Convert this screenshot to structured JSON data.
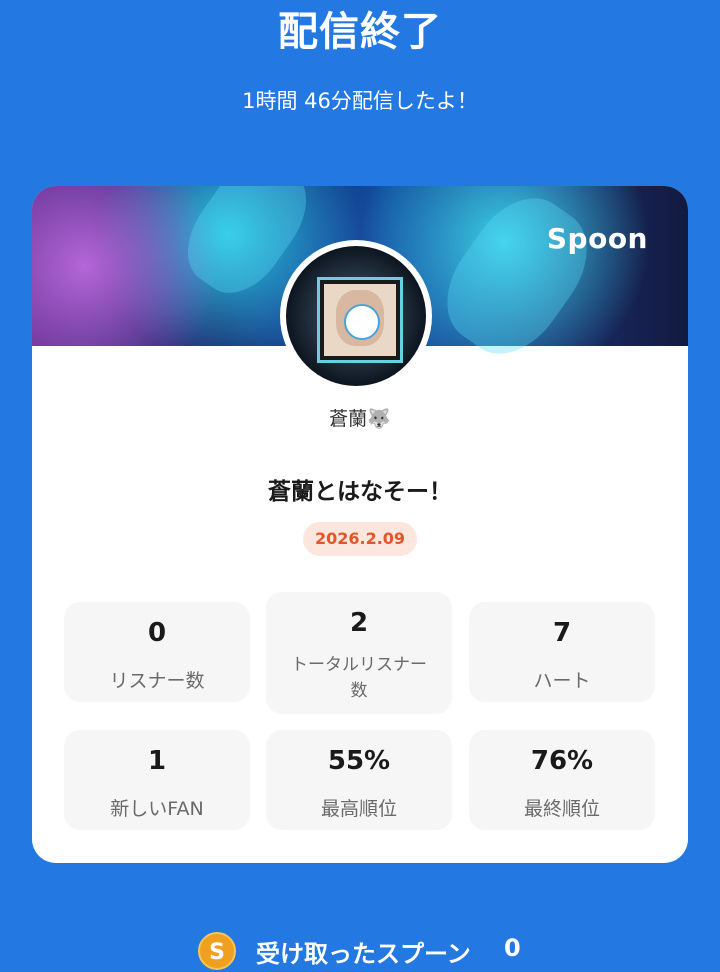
{
  "header": {
    "title": "配信終了",
    "subtitle": "1時間 46分配信したよ！"
  },
  "card": {
    "brand": "Spoon",
    "username": "蒼蘭🐺",
    "stream_title": "蒼蘭とはなそー！",
    "date": "2026.2.09",
    "stats": [
      {
        "value": "0",
        "label": "リスナー数"
      },
      {
        "value": "2",
        "label": "トータルリスナー数"
      },
      {
        "value": "7",
        "label": "ハート"
      },
      {
        "value": "1",
        "label": "新しいFAN"
      },
      {
        "value": "55%",
        "label": "最高順位"
      },
      {
        "value": "76%",
        "label": "最終順位"
      }
    ]
  },
  "spoons": {
    "coin_glyph": "S",
    "label": "受け取ったスプーン",
    "count": "0"
  },
  "colors": {
    "background": "#2478e2",
    "date_badge_text": "#e5552b",
    "date_badge_bg": "#fde6dd",
    "coin": "#f0a020"
  }
}
